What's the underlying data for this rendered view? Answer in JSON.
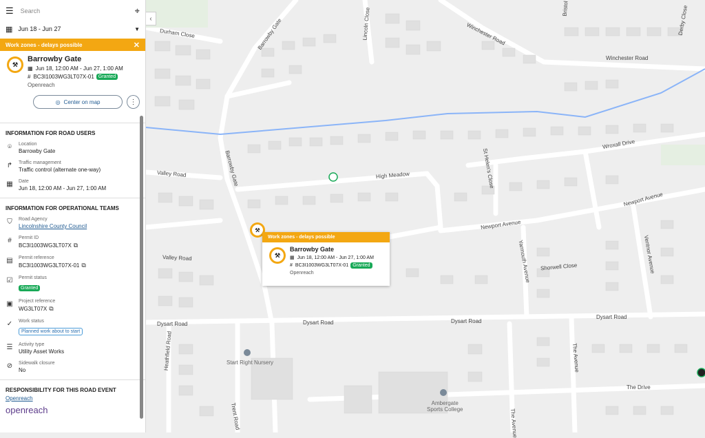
{
  "search": {
    "placeholder": "Search"
  },
  "date_range": {
    "label": "Jun 18 - Jun 27"
  },
  "banner": {
    "text": "Work zones - delays possible"
  },
  "event": {
    "title": "Barrowby Gate",
    "datetime": "Jun 18, 12:00 AM - Jun 27, 1:00 AM",
    "permit": "BC3I1003WG3LT07X-01",
    "status": "Granted",
    "org": "Openreach"
  },
  "actions": {
    "center_label": "Center on map"
  },
  "road_users": {
    "title": "INFORMATION FOR ROAD USERS",
    "location_label": "Location",
    "location_value": "Barrowby Gate",
    "traffic_label": "Traffic management",
    "traffic_value": "Traffic control (alternate one-way)",
    "date_label": "Date",
    "date_value": "Jun 18, 12:00 AM - Jun 27, 1:00 AM"
  },
  "op_teams": {
    "title": "INFORMATION FOR OPERATIONAL TEAMS",
    "agency_label": "Road Agency",
    "agency_value": "Lincolnshire County Council",
    "permit_id_label": "Permit ID",
    "permit_id_value": "BC3I1003WG3LT07X",
    "permit_ref_label": "Permit reference",
    "permit_ref_value": "BC3I1003WG3LT07X-01",
    "permit_status_label": "Permit status",
    "permit_status_value": "Granted",
    "project_ref_label": "Project reference",
    "project_ref_value": "WG3LT07X",
    "work_status_label": "Work status",
    "work_status_value": "Planned work about to start",
    "activity_label": "Activity type",
    "activity_value": "Utility Asset Works",
    "sidewalk_label": "Sidewalk closure",
    "sidewalk_value": "No"
  },
  "responsibility": {
    "title": "RESPONSIBILITY FOR THIS ROAD EVENT",
    "org_link": "Openreach",
    "logo_text": "openreach"
  },
  "popup": {
    "banner": "Work zones - delays possible",
    "title": "Barrowby Gate",
    "datetime": "Jun 18, 12:00 AM - Jun 27, 1:00 AM",
    "permit": "BC3I1003WG3LT07X-01",
    "status": "Granted",
    "org": "Openreach"
  },
  "map_labels": {
    "durham_close": "Durham Close",
    "barrowby_gate": "Barrowby Gate",
    "lincoln_close": "Lincoln Close",
    "winchester_road": "Winchester Road",
    "bristol": "Bristol",
    "derby_close": "Derby Close",
    "wroxall_drive": "Wroxall Drive",
    "valley_road": "Valley Road",
    "high_meadow": "High Meadow",
    "newport_avenue": "Newport Avenue",
    "yarmouth_avenue": "Yarmouth Avenue",
    "shorwell_close": "Shorwell Close",
    "ventnor_avenue": "Ventnor Avenue",
    "dysart_road": "Dysart Road",
    "heathfield_road": "Heathfield Road",
    "trent_road": "Trent Road",
    "the_avenue": "The Avenue",
    "the_drive": "The Drive",
    "st_helens": "St Helen's Close",
    "start_right": "Start Right Nursery",
    "ambergate": "Ambergate\nSports College"
  },
  "colors": {
    "accent": "#f3a712",
    "granted": "#18a957",
    "link": "#1f5a91",
    "water": "#8ab4f8"
  }
}
